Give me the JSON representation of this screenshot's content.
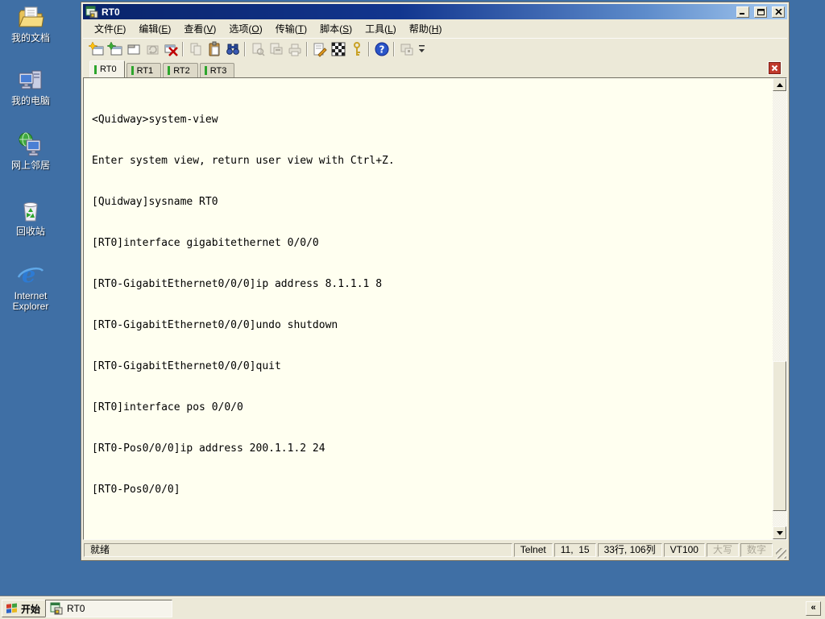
{
  "colors": {
    "desktop_blue": "#3F6FA5",
    "titlebar_gradient_left": "#0A246A",
    "titlebar_gradient_right": "#A6CAF0",
    "window_chrome": "#ECE9D8",
    "terminal_background": "#FFFFF0",
    "tab_indicator_green": "#2CA52C",
    "tab_close_red": "#C0392B"
  },
  "desktop": {
    "icons": [
      {
        "icon": "my-documents-icon",
        "label": "我的文档"
      },
      {
        "icon": "my-computer-icon",
        "label": "我的电脑"
      },
      {
        "icon": "network-places-icon",
        "label": "网上邻居"
      },
      {
        "icon": "recycle-bin-icon",
        "label": "回收站"
      },
      {
        "icon": "internet-explorer-icon",
        "label": "Internet Explorer"
      }
    ]
  },
  "window": {
    "title": "RT0",
    "menu": {
      "items": [
        {
          "pre": "文件(",
          "key": "F",
          "suf": ")"
        },
        {
          "pre": "编辑(",
          "key": "E",
          "suf": ")"
        },
        {
          "pre": "查看(",
          "key": "V",
          "suf": ")"
        },
        {
          "pre": "选项(",
          "key": "O",
          "suf": ")"
        },
        {
          "pre": "传输(",
          "key": "T",
          "suf": ")"
        },
        {
          "pre": "脚本(",
          "key": "S",
          "suf": ")"
        },
        {
          "pre": "工具(",
          "key": "L",
          "suf": ")"
        },
        {
          "pre": "帮助(",
          "key": "H",
          "suf": ")"
        }
      ]
    },
    "toolbar": {
      "icons": [
        "quick-connect",
        "connect",
        "connect-in-tab",
        "reconnect",
        "disconnect",
        "copy",
        "paste",
        "find",
        "print-preview",
        "print-setup",
        "print",
        "properties",
        "session-options",
        "security-key",
        "help",
        "session-manager",
        "toolbar-overflow"
      ]
    },
    "tabs": [
      {
        "label": "RT0"
      },
      {
        "label": "RT1"
      },
      {
        "label": "RT2"
      },
      {
        "label": "RT3"
      }
    ],
    "terminal": {
      "lines": [
        "<Quidway>system-view",
        "Enter system view, return user view with Ctrl+Z.",
        "[Quidway]sysname RT0",
        "[RT0]interface gigabitethernet 0/0/0",
        "[RT0-GigabitEthernet0/0/0]ip address 8.1.1.1 8",
        "[RT0-GigabitEthernet0/0/0]undo shutdown",
        "[RT0-GigabitEthernet0/0/0]quit",
        "[RT0]interface pos 0/0/0",
        "[RT0-Pos0/0/0]ip address 200.1.1.2 24",
        "[RT0-Pos0/0/0]"
      ]
    },
    "statusbar": {
      "ready": "就绪",
      "protocol": "Telnet",
      "cursor": "11,  15",
      "size": "33行, 106列",
      "emulation": "VT100",
      "caps": "大写",
      "num": "数字"
    }
  },
  "taskbar": {
    "start_label": "开始",
    "task_label": "RT0",
    "collapse_glyph": "«"
  }
}
